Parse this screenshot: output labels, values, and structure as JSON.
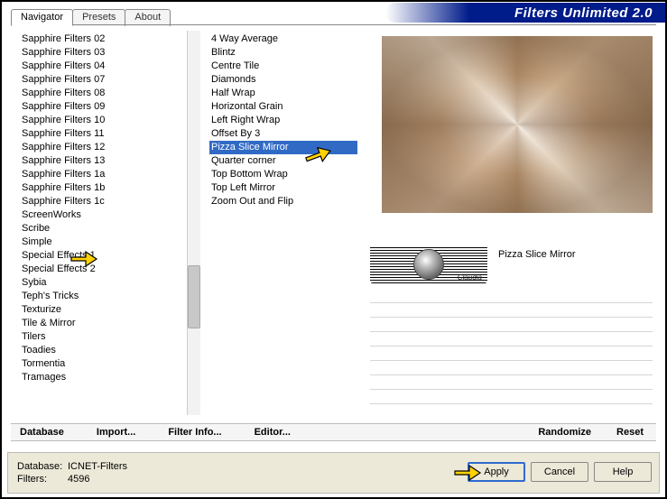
{
  "title": "Filters Unlimited 2.0",
  "tabs": [
    "Navigator",
    "Presets",
    "About"
  ],
  "active_tab": 0,
  "categories": [
    "Sapphire Filters 02",
    "Sapphire Filters 03",
    "Sapphire Filters 04",
    "Sapphire Filters 07",
    "Sapphire Filters 08",
    "Sapphire Filters 09",
    "Sapphire Filters 10",
    "Sapphire Filters 11",
    "Sapphire Filters 12",
    "Sapphire Filters 13",
    "Sapphire Filters 1a",
    "Sapphire Filters 1b",
    "Sapphire Filters 1c",
    "ScreenWorks",
    "Scribe",
    "Simple",
    "Special Effects 1",
    "Special Effects 2",
    "Sybia",
    "Teph's Tricks",
    "Texturize",
    "Tile & Mirror",
    "Tilers",
    "Toadies",
    "Tormentia",
    "Tramages"
  ],
  "selected_category_index": 15,
  "filters": [
    "4 Way Average",
    "Blintz",
    "Centre Tile",
    "Diamonds",
    "Half Wrap",
    "Horizontal Grain",
    "Left Right Wrap",
    "Offset By 3",
    "Pizza Slice Mirror",
    "Quarter corner",
    "Top Bottom Wrap",
    "Top Left Mirror",
    "Zoom Out and Flip"
  ],
  "selected_filter_index": 8,
  "selected_filter_name": "Pizza Slice Mirror",
  "logo_label": "Claudia",
  "toolbar": {
    "database": "Database",
    "import": "Import...",
    "filter_info": "Filter Info...",
    "editor": "Editor...",
    "randomize": "Randomize",
    "reset": "Reset"
  },
  "status": {
    "db_label": "Database:",
    "db_value": "ICNET-Filters",
    "filters_label": "Filters:",
    "filters_value": "4596"
  },
  "buttons": {
    "apply": "Apply",
    "cancel": "Cancel",
    "help": "Help"
  }
}
